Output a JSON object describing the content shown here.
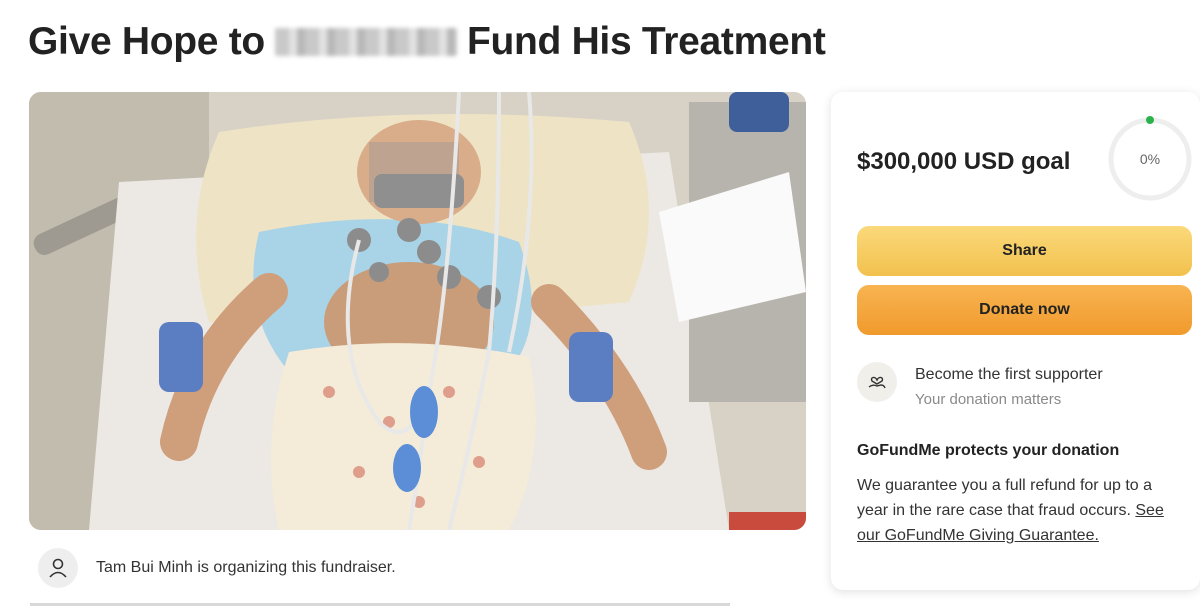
{
  "title": {
    "before": "Give Hope to",
    "after": "Fund His Treatment"
  },
  "photo": {
    "alt": "child in hospital bed with ECG electrodes"
  },
  "organizer": {
    "text": "Tam Bui Minh is organizing this fundraiser.",
    "icon": "person-icon"
  },
  "card": {
    "goal": "$300,000 USD goal",
    "progress_label": "0%",
    "progress_fraction": 0,
    "share_label": "Share",
    "donate_label": "Donate now",
    "supporter": {
      "icon": "heart-hand-icon",
      "line1": "Become the first supporter",
      "line2": "Your donation matters"
    },
    "protect": {
      "title": "GoFundMe protects your donation",
      "body": "We guarantee you a full refund for up to a year in the rare case that fraud occurs.",
      "link": "See our GoFundMe Giving Guarantee."
    }
  },
  "colors": {
    "share": "#f2c14e",
    "donate": "#f09a2c",
    "progress_dot": "#2bb24c"
  }
}
